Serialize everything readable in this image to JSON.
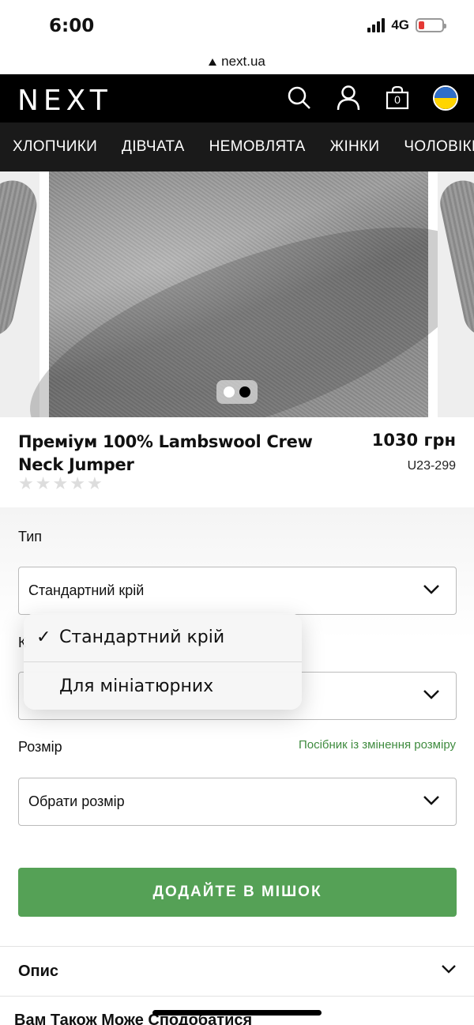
{
  "status_bar": {
    "time": "6:00",
    "network": "4G"
  },
  "browser": {
    "url": "next.ua"
  },
  "header": {
    "logo": "NEXT",
    "bag_count": "0",
    "icons": [
      "search-icon",
      "account-icon",
      "bag-icon",
      "ukraine-flag-icon"
    ]
  },
  "nav": {
    "items": [
      "ХЛОПЧИКИ",
      "ДІВЧАТА",
      "НЕМОВЛЯТА",
      "ЖІНКИ",
      "ЧОЛОВІКИ"
    ]
  },
  "gallery": {
    "image_count": 2,
    "active_index": 1
  },
  "product": {
    "title": "Преміум 100% Lambswool Crew Neck Jumper",
    "price": "1030 грн",
    "code": "U23-299",
    "rating": 0,
    "rating_max": 5
  },
  "options": {
    "type_label": "Тип",
    "type_value": "Стандартний крій",
    "color_label": "К",
    "size_label": "Розмір",
    "size_guide": "Посібник із змінення розміру",
    "size_value": "Обрати розмір",
    "add_button": "ДОДАЙТЕ В МІШОК"
  },
  "dropdown": {
    "options": [
      {
        "label": "Стандартний крій",
        "selected": true
      },
      {
        "label": "Для мініатюрних",
        "selected": false
      }
    ]
  },
  "description": {
    "title": "Опис"
  },
  "also_like": {
    "title": "Вам Також Може Сподобатися"
  },
  "colors": {
    "accent_green": "#55a156",
    "link_green": "#3f8b3f",
    "header_bg": "#000000",
    "nav_bg": "#1a1a1a"
  }
}
